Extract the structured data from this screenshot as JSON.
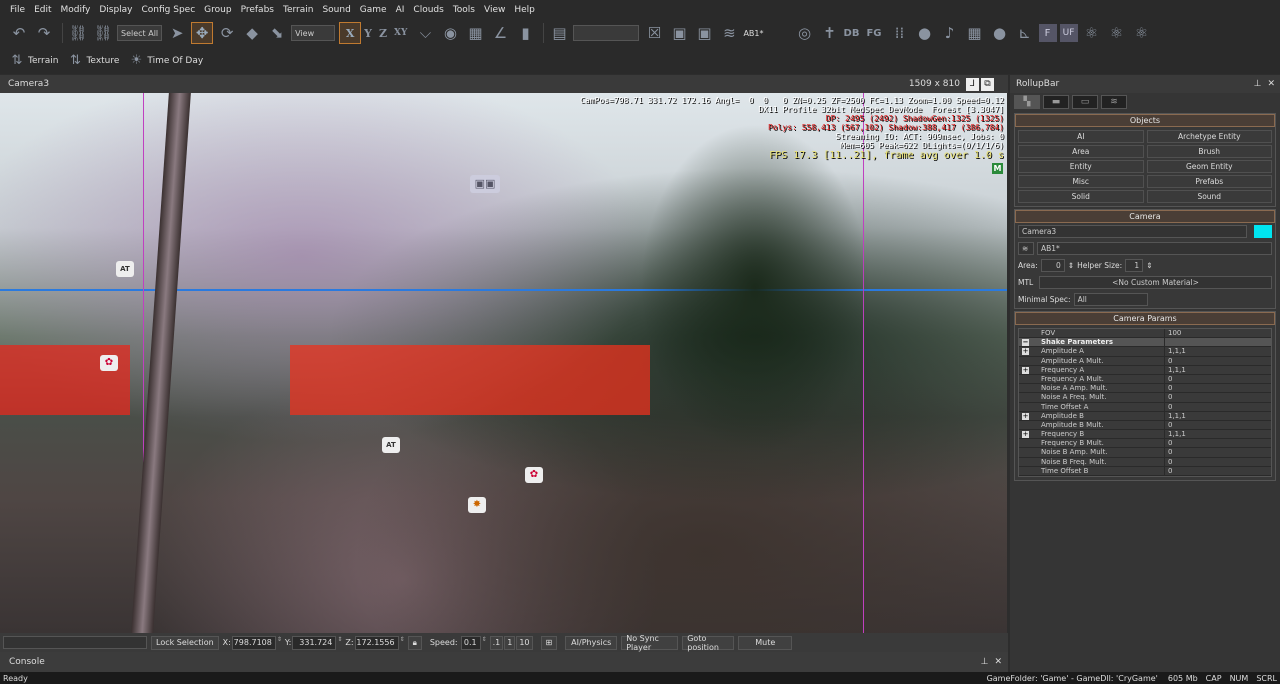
{
  "menu": [
    "File",
    "Edit",
    "Modify",
    "Display",
    "Config Spec",
    "Group",
    "Prefabs",
    "Terrain",
    "Sound",
    "Game",
    "AI",
    "Clouds",
    "Tools",
    "View",
    "Help"
  ],
  "toolbar": {
    "select_all": "Select All",
    "view": "View",
    "axis_x": "X",
    "axis_y": "Y",
    "axis_z": "Z",
    "axis_xy": "XY",
    "layer": "AB1*",
    "db": "DB",
    "fg": "FG",
    "f": "F",
    "uf": "UF"
  },
  "toolbar2": {
    "terrain": "Terrain",
    "texture": "Texture",
    "time_of_day": "Time Of Day"
  },
  "viewport": {
    "title": "Camera3",
    "resolution": "1509 x 810",
    "overlay": {
      "line1": "CamPos=798.71 331.72 172.16 Angl=  0  0   0 ZN=0.25 ZF=2500 FC=1.13 Zoom=1.00 Speed=0.12",
      "line2": "DX11 Profile 32bit MedSpec DevMode  Forest [3.3047]",
      "line3": "DP: 2495 (2492) ShadowGen:1325 (1325)",
      "line4": "Polys: 558,413 (567,102) Shadow:388,417 (386,784)",
      "line5": "Streaming IO: ACT: 909msec, Jobs: 0",
      "line6": "Mem=605 Peak=622 DLights=(0/1/1/6)",
      "fps": "FPS 17.3 [11..21], frame avg over 1.0 s",
      "m_badge": "M"
    },
    "colors": {
      "overlay_red": "#e02020",
      "overlay_fps": "#e8e070",
      "overlay_white": "#ffffff"
    }
  },
  "bottom": {
    "lock_selection": "Lock Selection",
    "x_label": "X:",
    "x": "798.7108",
    "y_label": "Y:",
    "y": "331.724",
    "z_label": "Z:",
    "z": "172.1556",
    "speed_label": "Speed:",
    "speed": "0.1",
    "s1": ".1",
    "s2": "1",
    "s3": "10",
    "ai_physics": "AI/Physics",
    "no_sync": "No Sync Player",
    "goto": "Goto position",
    "mute": "Mute"
  },
  "console": {
    "title": "Console"
  },
  "status": {
    "ready": "Ready",
    "game_info": "GameFolder: 'Game' - GameDll: 'CryGame'",
    "mem": "605 Mb",
    "cap": "CAP",
    "num": "NUM",
    "scrl": "SCRL"
  },
  "rollup": {
    "title": "RollupBar",
    "objects": {
      "title": "Objects",
      "buttons": [
        "AI",
        "Archetype Entity",
        "Area",
        "Brush",
        "Entity",
        "Geom Entity",
        "Misc",
        "Prefabs",
        "Solid",
        "Sound"
      ]
    },
    "camera": {
      "title": "Camera",
      "name": "Camera3",
      "color": "#00e5f0",
      "layer": "AB1*",
      "area_label": "Area:",
      "area": "0",
      "helper_label": "Helper Size:",
      "helper": "1",
      "mtl_label": "MTL",
      "mtl": "<No Custom Material>",
      "minspec_label": "Minimal Spec:",
      "minspec": "All"
    },
    "params": {
      "title": "Camera Params",
      "rows": [
        {
          "k": "FOV",
          "v": "100"
        },
        {
          "k": "Shake Parameters",
          "v": ""
        },
        {
          "k": "Amplitude A",
          "v": "1,1,1"
        },
        {
          "k": "Amplitude A Mult.",
          "v": "0"
        },
        {
          "k": "Frequency A",
          "v": "1,1,1"
        },
        {
          "k": "Frequency A Mult.",
          "v": "0"
        },
        {
          "k": "Noise A Amp. Mult.",
          "v": "0"
        },
        {
          "k": "Noise A Freq. Mult.",
          "v": "0"
        },
        {
          "k": "Time Offset A",
          "v": "0"
        },
        {
          "k": "Amplitude B",
          "v": "1,1,1"
        },
        {
          "k": "Amplitude B Mult.",
          "v": "0"
        },
        {
          "k": "Frequency B",
          "v": "1,1,1"
        },
        {
          "k": "Frequency B Mult.",
          "v": "0"
        },
        {
          "k": "Noise B Amp. Mult.",
          "v": "0"
        },
        {
          "k": "Noise B Freq. Mult.",
          "v": "0"
        },
        {
          "k": "Time Offset B",
          "v": "0"
        }
      ]
    }
  }
}
